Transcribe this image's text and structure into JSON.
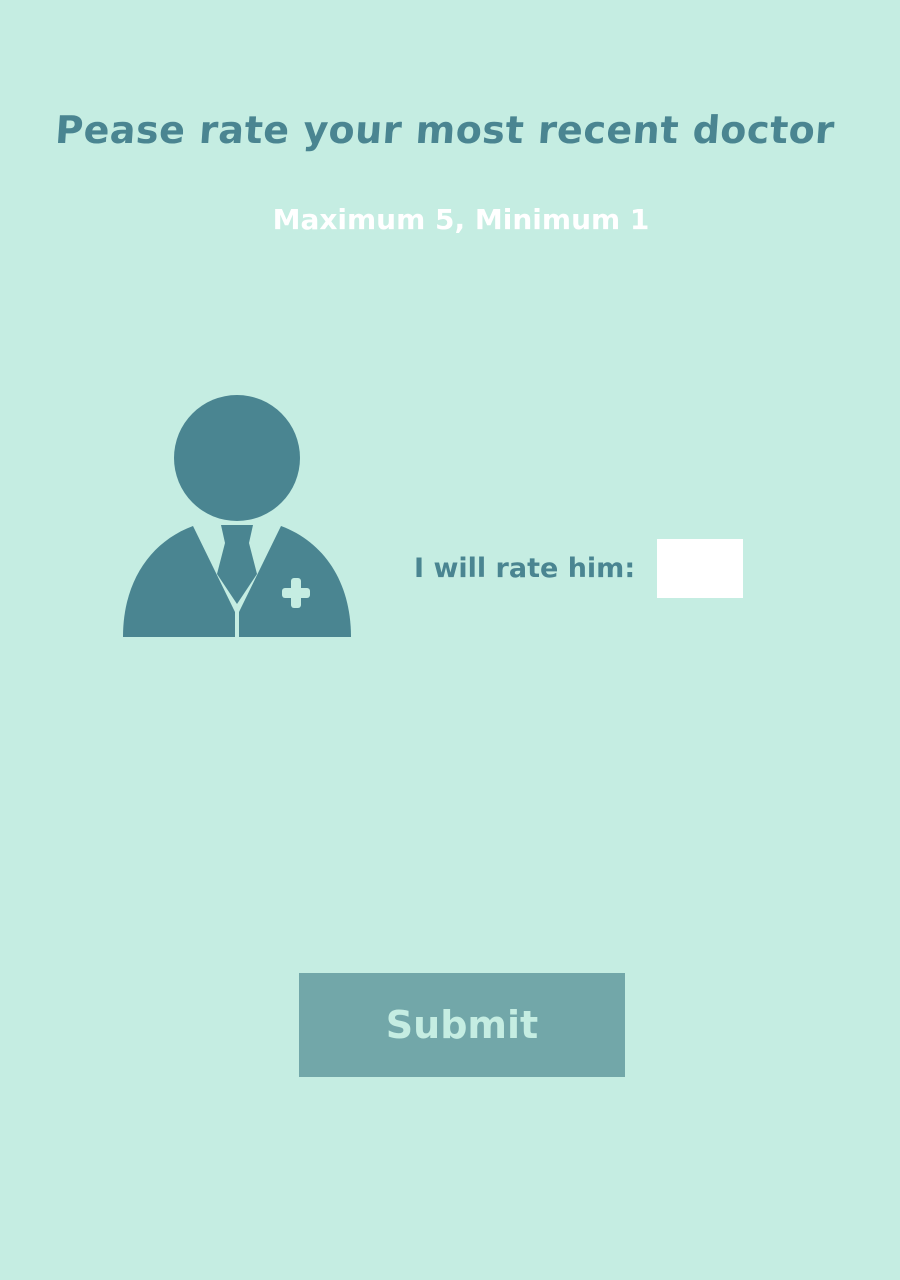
{
  "header": {
    "title": "Pease rate your most recent doctor",
    "subtitle": "Maximum 5, Minimum 1"
  },
  "illustration": {
    "icon": "doctor-icon",
    "color": "#4a8591"
  },
  "rating": {
    "label": "I will rate him:",
    "value": "",
    "placeholder": ""
  },
  "actions": {
    "submit_label": "Submit"
  },
  "colors": {
    "background": "#c5ede2",
    "accent": "#4a8591",
    "button": "#72a7a9"
  }
}
